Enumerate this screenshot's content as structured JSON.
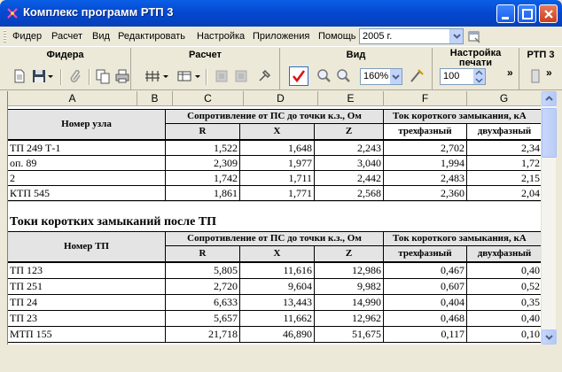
{
  "window": {
    "title": "Комплекс программ РТП 3"
  },
  "menu": {
    "items": [
      "Фидер",
      "Расчет",
      "Вид",
      "Редактировать",
      "Настройка",
      "Приложения",
      "Помощь"
    ],
    "year": "2005 г."
  },
  "toolbars": {
    "feeders": "Фидера",
    "calc": "Расчет",
    "view": "Вид",
    "print_settings": "Настройка печати",
    "rtp": "РТП 3",
    "zoom": "160%",
    "print_value": "100",
    "more": "»"
  },
  "columns": [
    "A",
    "B",
    "C",
    "D",
    "E",
    "F",
    "G"
  ],
  "table1": {
    "node_header": "Номер узла",
    "resistance_header": "Сопротивление от ПС до точки к.з., Ом",
    "current_header": "Ток короткого замыкания, кА",
    "sub": [
      "R",
      "X",
      "Z",
      "трехфазный",
      "двухфазный"
    ],
    "rows": [
      {
        "name": "ТП 249 Т-1",
        "r": "1,522",
        "x": "1,648",
        "z": "2,243",
        "i3": "2,702",
        "i2": "2,34"
      },
      {
        "name": "оп. 89",
        "r": "2,309",
        "x": "1,977",
        "z": "3,040",
        "i3": "1,994",
        "i2": "1,72"
      },
      {
        "name": "2",
        "r": "1,742",
        "x": "1,711",
        "z": "2,442",
        "i3": "2,483",
        "i2": "2,15"
      },
      {
        "name": "КТП 545",
        "r": "1,861",
        "x": "1,771",
        "z": "2,568",
        "i3": "2,360",
        "i2": "2,04"
      }
    ]
  },
  "table2": {
    "title": "Токи коротких замыканий после ТП",
    "node_header": "Номер ТП",
    "resistance_header": "Сопротивление от ПС до точки к.з., Ом",
    "current_header": "Ток короткого замыкания, кА",
    "sub": [
      "R",
      "X",
      "Z",
      "трехфазный",
      "двухфазный"
    ],
    "rows": [
      {
        "name": "ТП 123",
        "r": "5,805",
        "x": "11,616",
        "z": "12,986",
        "i3": "0,467",
        "i2": "0,40"
      },
      {
        "name": "ТП 251",
        "r": "2,720",
        "x": "9,604",
        "z": "9,982",
        "i3": "0,607",
        "i2": "0,52"
      },
      {
        "name": "ТП 24",
        "r": "6,633",
        "x": "13,443",
        "z": "14,990",
        "i3": "0,404",
        "i2": "0,35"
      },
      {
        "name": "ТП 23",
        "r": "5,657",
        "x": "11,662",
        "z": "12,962",
        "i3": "0,468",
        "i2": "0,40"
      },
      {
        "name": "МТП 155",
        "r": "21,718",
        "x": "46,890",
        "z": "51,675",
        "i3": "0,117",
        "i2": "0,10"
      }
    ]
  }
}
